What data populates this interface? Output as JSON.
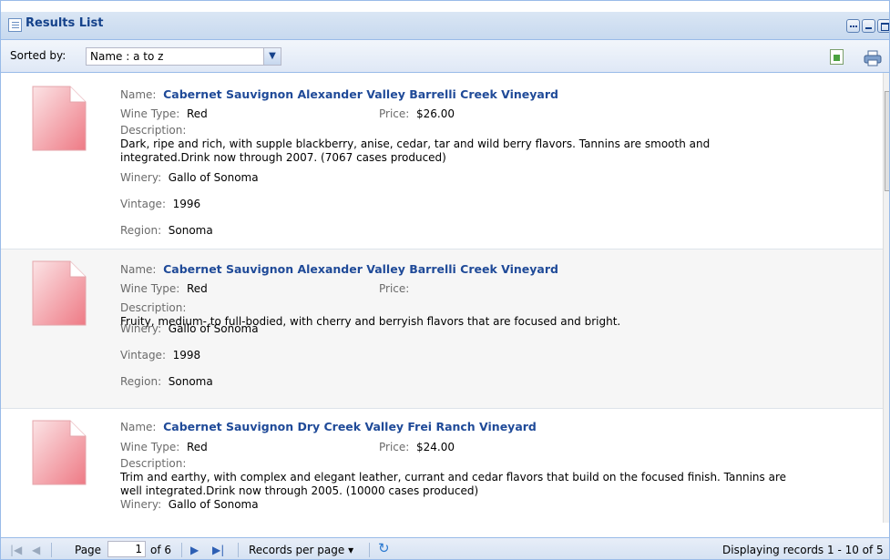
{
  "window": {
    "title": "Results List"
  },
  "toolbar": {
    "sort_label": "Sorted by:",
    "sort_value": "Name : a to z"
  },
  "labels": {
    "name": "Name:",
    "wine_type": "Wine Type:",
    "price": "Price:",
    "description": "Description:",
    "winery": "Winery:",
    "vintage": "Vintage:",
    "region": "Region:"
  },
  "records": [
    {
      "name": "Cabernet Sauvignon Alexander Valley Barrelli Creek Vineyard",
      "wine_type": "Red",
      "price": "$26.00",
      "description": "Dark, ripe and rich, with supple blackberry, anise, cedar, tar and wild berry flavors. Tannins are smooth and integrated.Drink now through 2007. (7067 cases produced)",
      "winery": "Gallo of Sonoma",
      "vintage": "1996",
      "region": "Sonoma"
    },
    {
      "name": "Cabernet Sauvignon Alexander Valley Barrelli Creek Vineyard",
      "wine_type": "Red",
      "price": "",
      "description": "Fruity, medium- to full-bodied, with cherry and berryish flavors that are focused and bright.",
      "winery": "Gallo of Sonoma",
      "vintage": "1998",
      "region": "Sonoma"
    },
    {
      "name": "Cabernet Sauvignon Dry Creek Valley Frei Ranch Vineyard",
      "wine_type": "Red",
      "price": "$24.00",
      "description": "Trim and earthy, with complex and elegant leather, currant and cedar flavors that build on the focused finish. Tannins are well integrated.Drink now through 2005. (10000 cases produced)",
      "winery": "Gallo of Sonoma"
    }
  ],
  "pager": {
    "page_label": "Page",
    "page_value": "1",
    "of_label": "of 6",
    "records_per_page": "Records per page",
    "display_info": "Displaying records 1 - 10 of 5"
  },
  "icons": [
    "results-list-icon",
    "window-options-icon",
    "minimize-icon",
    "maximize-icon",
    "close-icon",
    "chevron-down-icon",
    "export-icon",
    "print-icon",
    "document-icon",
    "first-page-icon",
    "prev-page-icon",
    "next-page-icon",
    "last-page-icon",
    "refresh-icon"
  ],
  "colors": {
    "title": "#15428b",
    "name_link": "#1f4a98",
    "border": "#99bbe8"
  }
}
